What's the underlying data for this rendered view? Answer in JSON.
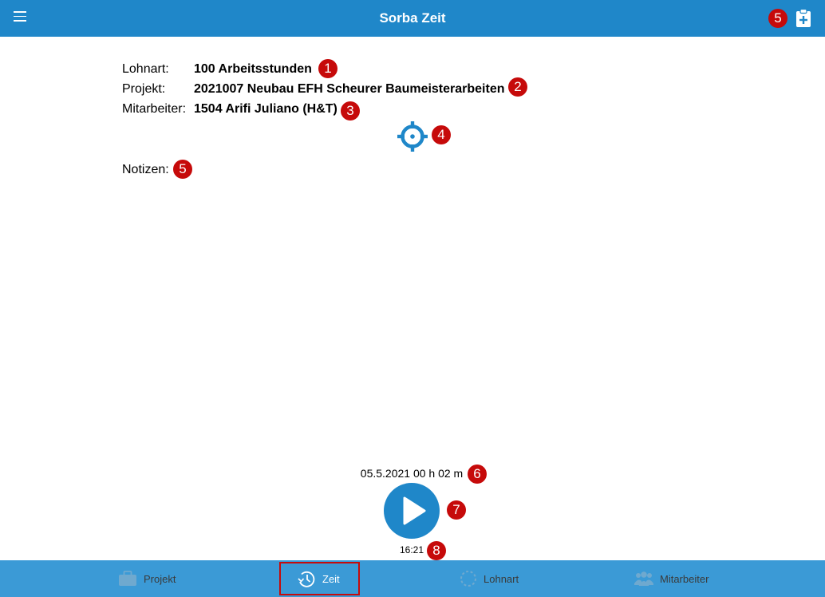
{
  "header": {
    "title": "Sorba Zeit",
    "marker_clipboard": "5"
  },
  "details": {
    "lohnart_label": "Lohnart:",
    "lohnart_value": "100 Arbeitsstunden",
    "projekt_label": "Projekt:",
    "projekt_value": "2021007 Neubau EFH Scheurer Baumeisterarbeiten",
    "mitarbeiter_label": "Mitarbeiter:",
    "mitarbeiter_value": "1504 Arifi Juliano (H&T)",
    "notizen_label": "Notizen:"
  },
  "markers": [
    "1",
    "2",
    "3",
    "4",
    "5",
    "6",
    "7",
    "8"
  ],
  "timer": {
    "duration": "05.5.2021 00 h 02 m",
    "clock": "16:21"
  },
  "tabs": [
    {
      "label": "Projekt",
      "icon": "briefcase-icon"
    },
    {
      "label": "Zeit",
      "icon": "clock-icon",
      "selected": true
    },
    {
      "label": "Lohnart",
      "icon": "dashed-circle-icon"
    },
    {
      "label": "Mitarbeiter",
      "icon": "users-icon"
    }
  ],
  "colors": {
    "primary": "#1f87c9",
    "tabbar": "#3b9ad6",
    "marker": "#c60a0a"
  }
}
